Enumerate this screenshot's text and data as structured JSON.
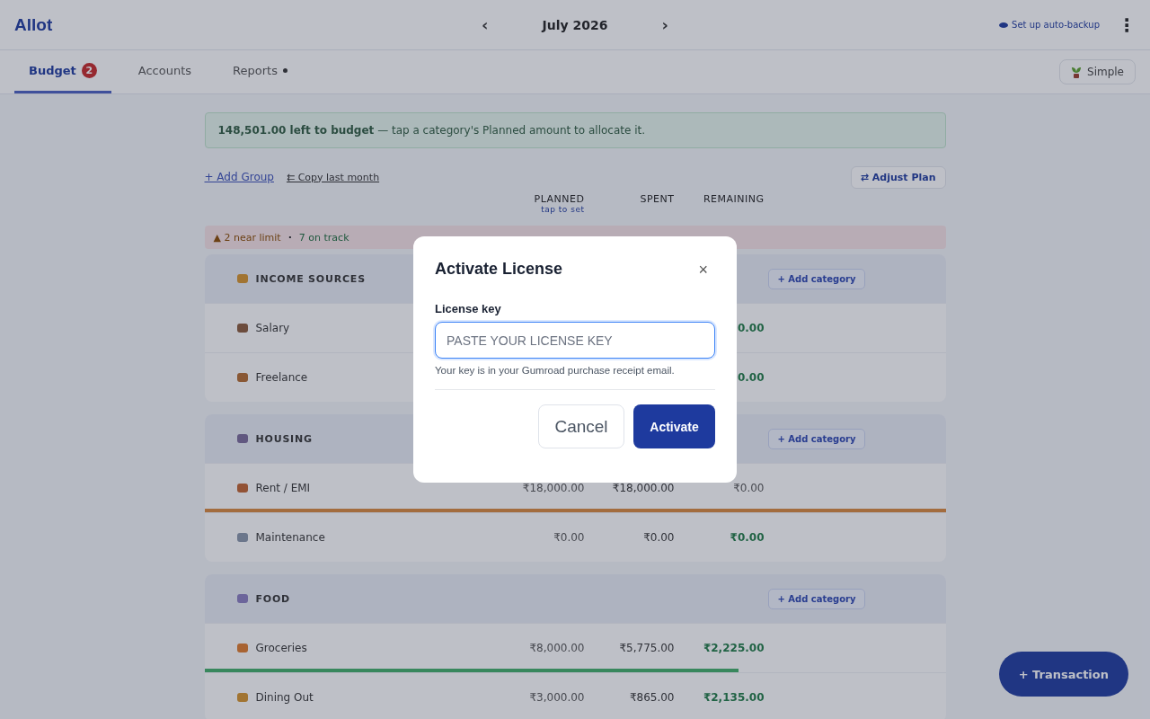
{
  "header": {
    "logo": "Allot",
    "prev": "‹",
    "month": "July 2026",
    "next": "›",
    "backup_link": "Set up auto-backup",
    "menu": "⋮"
  },
  "tabs": [
    {
      "label": "Budget",
      "badge": "2",
      "selected": true
    },
    {
      "label": "Accounts",
      "selected": false
    },
    {
      "label": "Reports",
      "dot": true,
      "selected": false
    }
  ],
  "mode_button": "Simple",
  "banner": {
    "text": "**148,501.00 left to budget** — tap a category's Planned amount to allocate it."
  },
  "actions": {
    "add_group": "+ Add Group",
    "copy_last": "⇇ Copy last month",
    "adjust_plan": "⇄ Adjust Plan"
  },
  "columns": [
    {
      "label": "PLANNED",
      "hint": "tap to set"
    },
    {
      "label": "SPENT"
    },
    {
      "label": "REMAINING"
    }
  ],
  "status": {
    "near_limit": "▲ 2 near limit",
    "separator": "·",
    "on_track": "7 on track"
  },
  "groups": [
    {
      "name": "INCOME SOURCES",
      "add": "+ Add category",
      "rows": [
        {
          "name": "Salary",
          "remaining": "0.00"
        },
        {
          "name": "Freelance",
          "remaining": "0.00"
        }
      ]
    },
    {
      "name": "HOUSING",
      "add": "+ Add category",
      "rows": [
        {
          "name": "Rent / EMI",
          "planned": "₹18,000.00",
          "spent": "₹18,000.00",
          "remaining": "₹0.00",
          "level": 1,
          "color": "#a36d3e",
          "remaining_positive": false
        },
        {
          "name": "Maintenance",
          "planned": "₹0.00",
          "spent": "₹0.00",
          "remaining": "₹0.00",
          "remaining_positive": true
        }
      ]
    },
    {
      "name": "FOOD",
      "add": "+ Add category",
      "rows": [
        {
          "name": "Groceries",
          "planned": "₹8,000.00",
          "spent": "₹5,775.00",
          "remaining": "₹2,225.00",
          "level": 0.72,
          "color": "#38885e",
          "remaining_positive": true
        },
        {
          "name": "Dining Out",
          "planned": "₹3,000.00",
          "spent": "₹865.00",
          "remaining": "₹2,135.00",
          "remaining_positive": true
        }
      ]
    }
  ],
  "fab": "+ Transaction",
  "dialog": {
    "title": "Activate License",
    "close": "×",
    "field_label": "License key",
    "placeholder": "PASTE YOUR LICENSE KEY",
    "help": "Your key is in your Gumroad purchase receipt email.",
    "cancel": "Cancel",
    "confirm": "Activate"
  }
}
